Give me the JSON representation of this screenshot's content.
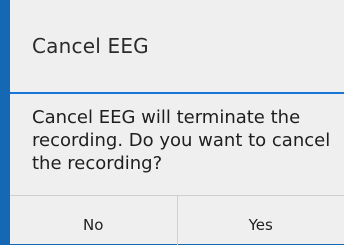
{
  "dialog": {
    "title": "Cancel EEG",
    "message": "Cancel EEG will terminate the recording. Do you want to cancel the recording?",
    "buttons": {
      "no_label": "No",
      "yes_label": "Yes"
    }
  },
  "colors": {
    "backdrop": "#1668b4",
    "accent": "#1777d9",
    "dialog_bg": "#efefef"
  }
}
